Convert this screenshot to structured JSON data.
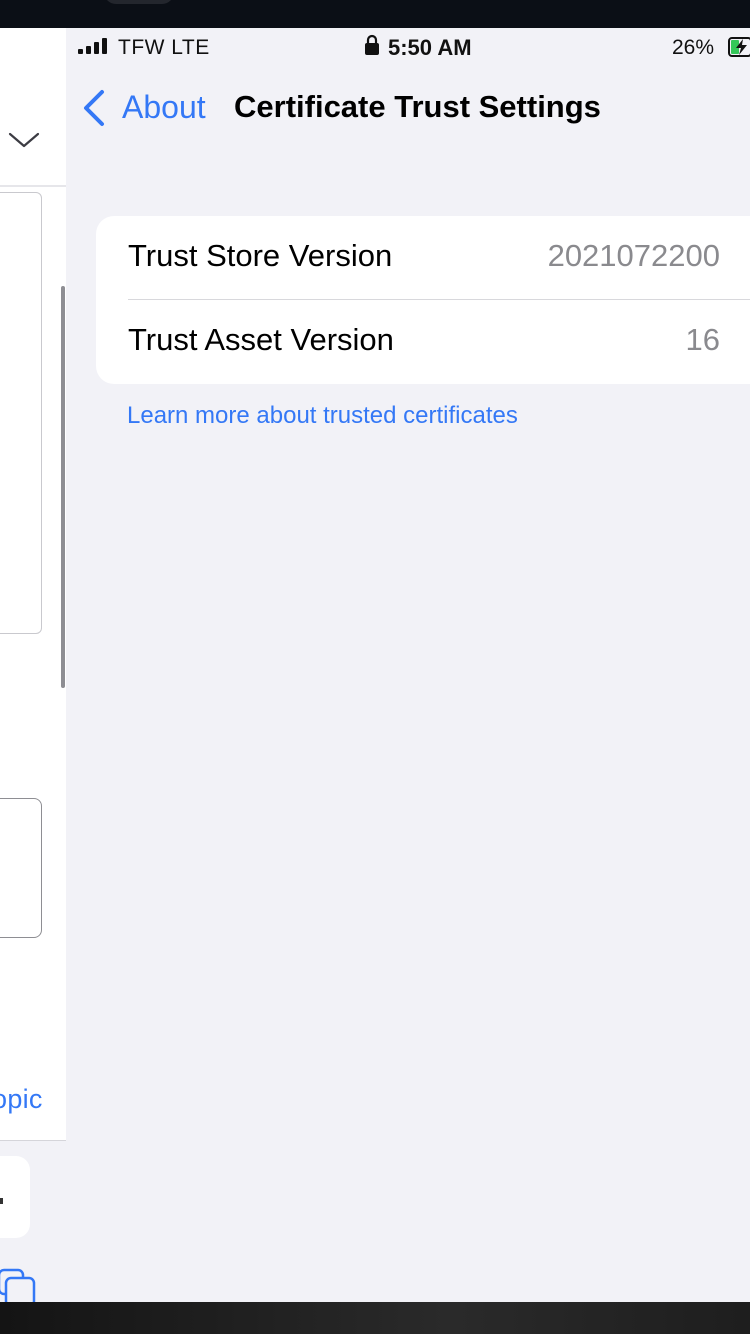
{
  "status_bar": {
    "carrier": "TFW  LTE",
    "time": "5:50 AM",
    "battery": "26%",
    "signal_icon": "signal-bars-icon",
    "lock_icon": "lock-icon",
    "battery_icon": "battery-charging-icon"
  },
  "nav": {
    "back_label": "About",
    "title": "Certificate Trust Settings"
  },
  "rows": [
    {
      "label": "Trust Store Version",
      "value": "2021072200"
    },
    {
      "label": "Trust Asset Version",
      "value": "16"
    }
  ],
  "link": "Learn more about trusted certificates",
  "background_app": {
    "partial_text": "opic"
  },
  "colors": {
    "accent": "#3478f6",
    "background": "#f2f2f7",
    "secondary_text": "#8a8a8e"
  }
}
